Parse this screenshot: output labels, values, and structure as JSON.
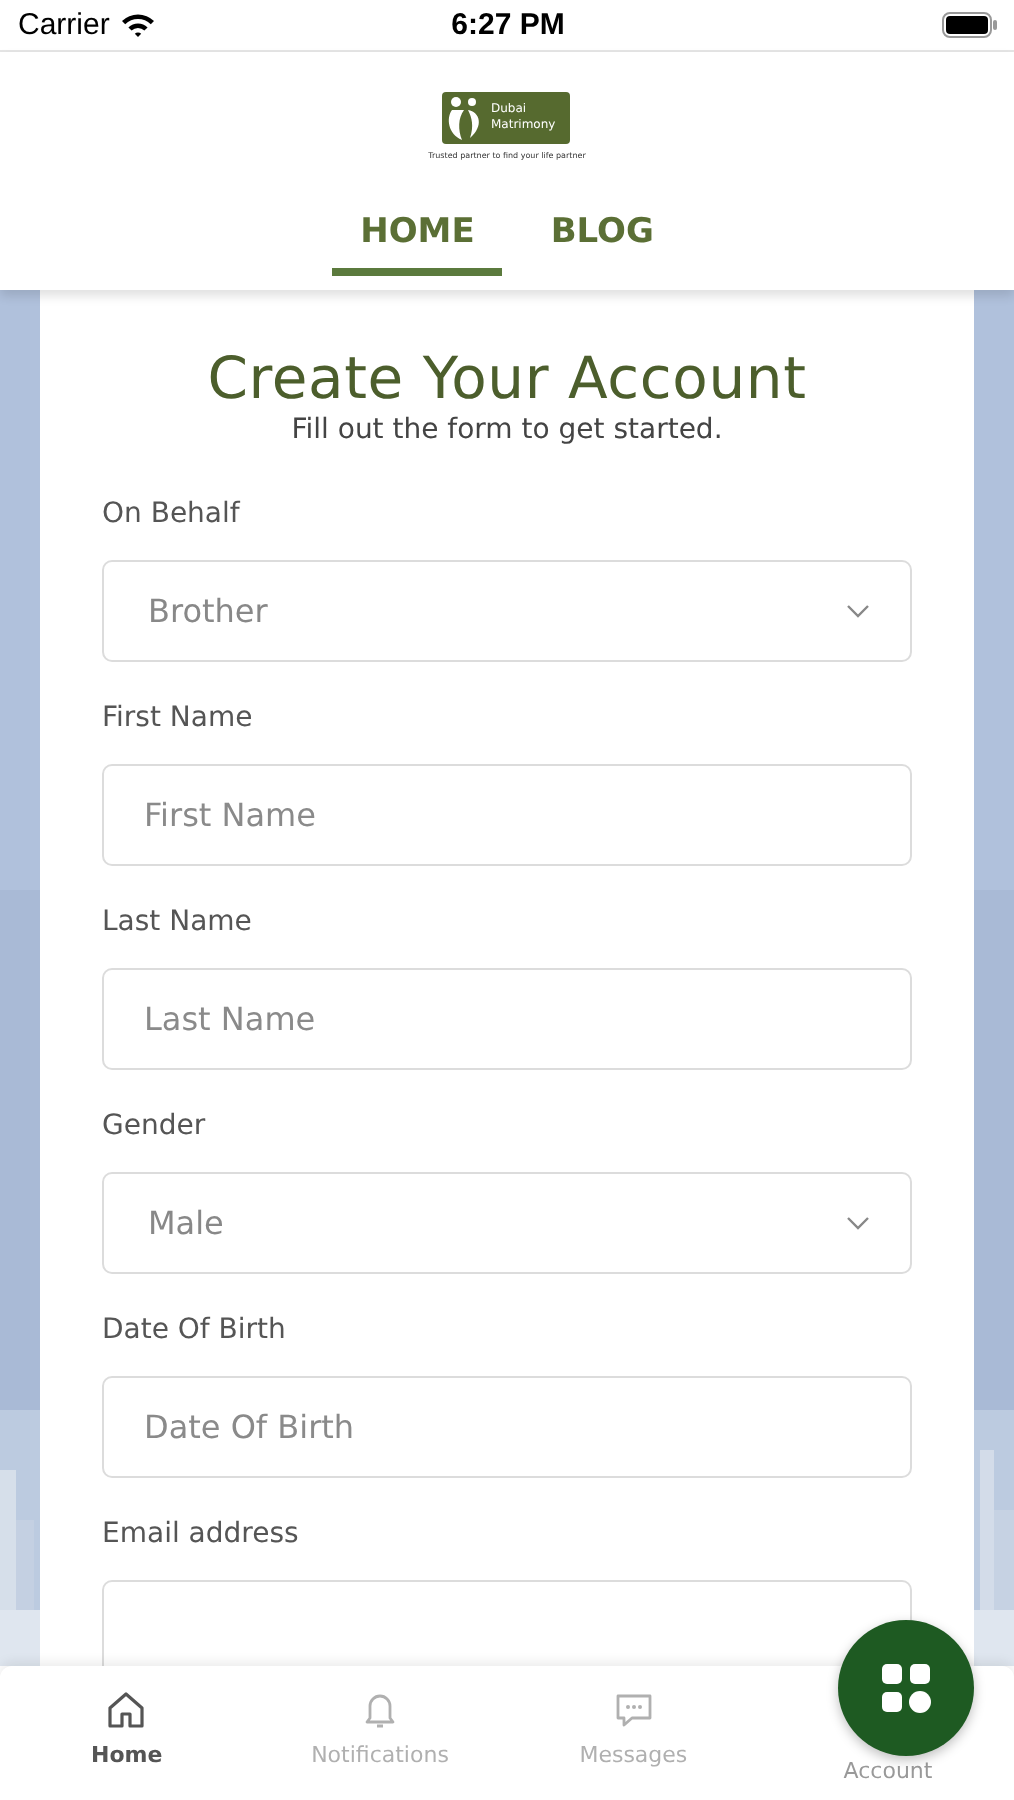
{
  "status_bar": {
    "carrier": "Carrier",
    "time": "6:27 PM"
  },
  "logo": {
    "name_line_1": "Dubai",
    "name_line_2": "Matrimony",
    "tagline": "Trusted partner to find your life partner"
  },
  "tabs": [
    {
      "label": "HOME",
      "selected": true
    },
    {
      "label": "BLOG",
      "selected": false
    }
  ],
  "form": {
    "title": "Create Your Account",
    "subtitle": "Fill out the form to get started.",
    "fields": [
      {
        "kind": "select",
        "label": "On Behalf",
        "value": "Brother"
      },
      {
        "kind": "text",
        "label": "First Name",
        "placeholder": "First Name"
      },
      {
        "kind": "text",
        "label": "Last Name",
        "placeholder": "Last Name"
      },
      {
        "kind": "select",
        "label": "Gender",
        "value": "Male"
      },
      {
        "kind": "text",
        "label": "Date Of Birth",
        "placeholder": "Date Of Birth"
      },
      {
        "kind": "text",
        "label": "Email address"
      }
    ]
  },
  "bottom_nav": [
    {
      "kind": "home",
      "label": "Home",
      "selected": true
    },
    {
      "kind": "bell",
      "label": "Notifications",
      "selected": false
    },
    {
      "kind": "chat",
      "label": "Messages",
      "selected": false
    },
    {
      "kind": "grid",
      "label": "Account",
      "selected": false
    }
  ]
}
